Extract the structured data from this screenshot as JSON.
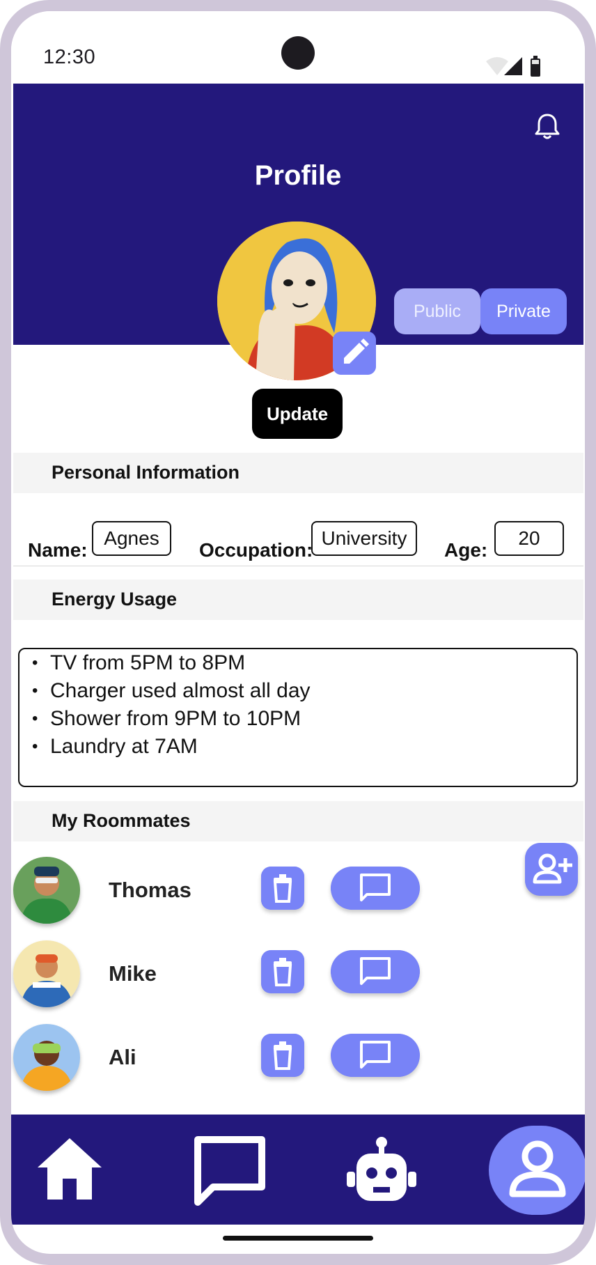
{
  "status_bar": {
    "time": "12:30"
  },
  "header": {
    "title": "Profile"
  },
  "visibility": {
    "public_label": "Public",
    "private_label": "Private",
    "selected": "Private"
  },
  "profile": {
    "update_label": "Update"
  },
  "personal_info": {
    "section_title": "Personal Information",
    "name_label": "Name:",
    "name_value": "Agnes",
    "occupation_label": "Occupation:",
    "occupation_value": "University",
    "age_label": "Age:",
    "age_value": "20"
  },
  "energy_usage": {
    "section_title": "Energy Usage",
    "items": [
      "TV from 5PM to 8PM",
      "Charger used almost all day",
      "Shower from 9PM to 10PM",
      "Laundry at 7AM"
    ]
  },
  "roommates": {
    "section_title": "My Roommates",
    "list": [
      {
        "name": "Thomas"
      },
      {
        "name": "Mike"
      },
      {
        "name": "Ali"
      }
    ]
  },
  "icons": {
    "bell": "bell-icon",
    "edit": "pencil-icon",
    "trash": "trash-icon",
    "chat": "chat-icon",
    "add_person": "add-person-icon",
    "home": "home-icon",
    "bot": "robot-icon",
    "profile": "person-icon"
  },
  "colors": {
    "header": "#23187c",
    "accent": "#7883f7",
    "accent_light": "#a9adf6",
    "frame": "#cfc6d9"
  }
}
